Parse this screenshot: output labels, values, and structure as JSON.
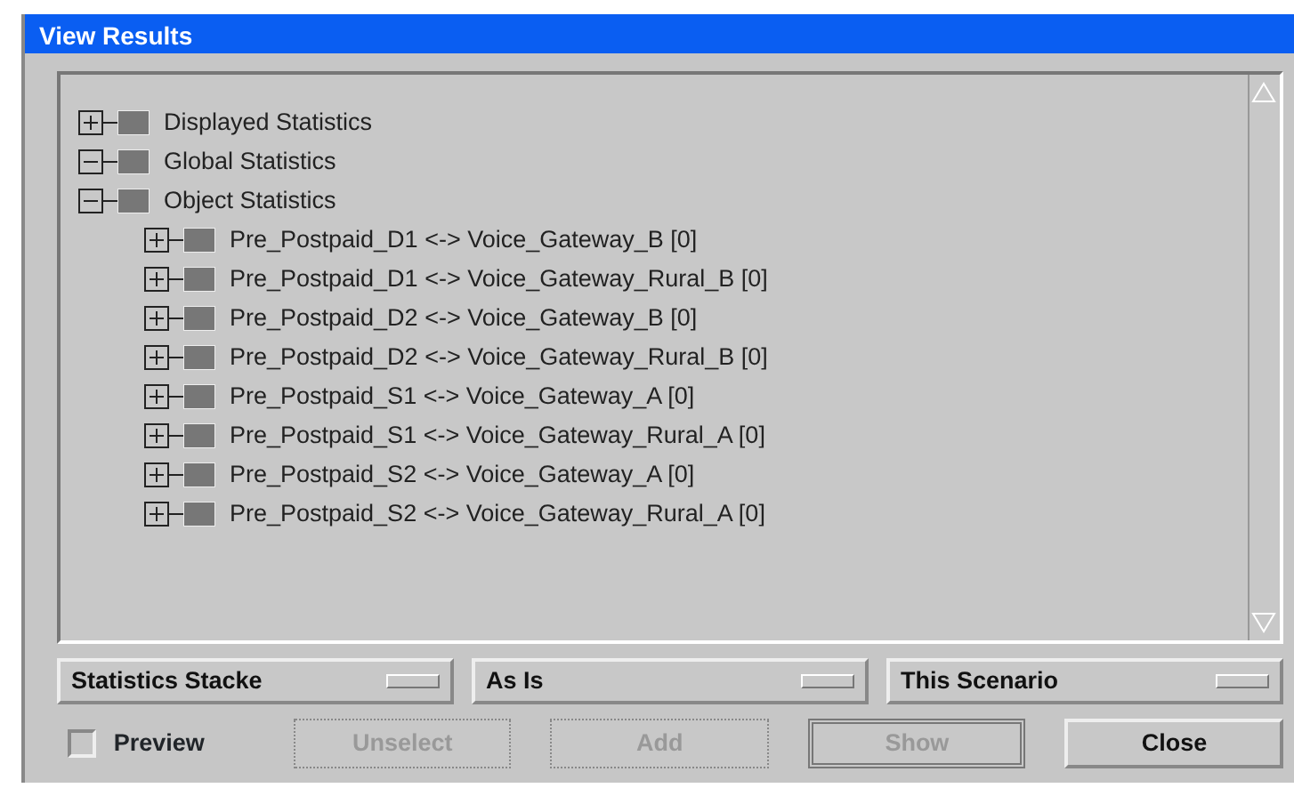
{
  "window": {
    "title": "View Results"
  },
  "tree": [
    {
      "label": "Displayed Statistics",
      "expanded": false
    },
    {
      "label": "Global Statistics",
      "expanded": true
    },
    {
      "label": "Object Statistics",
      "expanded": true,
      "children": [
        {
          "label": "Pre_Postpaid_D1 <-> Voice_Gateway_B [0]",
          "expanded": false
        },
        {
          "label": "Pre_Postpaid_D1 <-> Voice_Gateway_Rural_B [0]",
          "expanded": false
        },
        {
          "label": "Pre_Postpaid_D2 <-> Voice_Gateway_B [0]",
          "expanded": false
        },
        {
          "label": "Pre_Postpaid_D2 <-> Voice_Gateway_Rural_B [0]",
          "expanded": false
        },
        {
          "label": "Pre_Postpaid_S1 <-> Voice_Gateway_A [0]",
          "expanded": false
        },
        {
          "label": "Pre_Postpaid_S1 <-> Voice_Gateway_Rural_A [0]",
          "expanded": false
        },
        {
          "label": "Pre_Postpaid_S2 <-> Voice_Gateway_A [0]",
          "expanded": false
        },
        {
          "label": "Pre_Postpaid_S2 <-> Voice_Gateway_Rural_A [0]",
          "expanded": false
        }
      ]
    }
  ],
  "option_menus": [
    {
      "value": "Statistics Stacke"
    },
    {
      "value": "As Is"
    },
    {
      "value": "This Scenario"
    }
  ],
  "preview": {
    "label": "Preview",
    "checked": false
  },
  "buttons": [
    {
      "label": "Unselect",
      "disabled": true,
      "default": false
    },
    {
      "label": "Add",
      "disabled": true,
      "default": false
    },
    {
      "label": "Show",
      "disabled": true,
      "default": true
    },
    {
      "label": "Close",
      "disabled": false,
      "default": false
    }
  ]
}
